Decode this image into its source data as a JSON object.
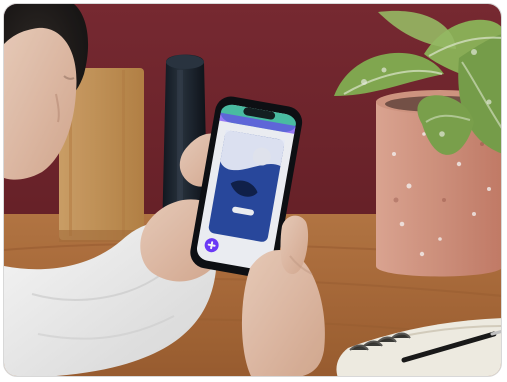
{
  "image": {
    "subject": "photo",
    "colors": {
      "wall": "#7a2a32",
      "desk": "#b9753f",
      "pot": "#d59a86",
      "leaf": "#8fb35a",
      "phone_screen_blue": "#2a4aa2",
      "sleeve": "#f2f2f2",
      "skin": "#e6c2ad",
      "paper": "#f7f4ea",
      "button": "#6f3cff"
    }
  }
}
